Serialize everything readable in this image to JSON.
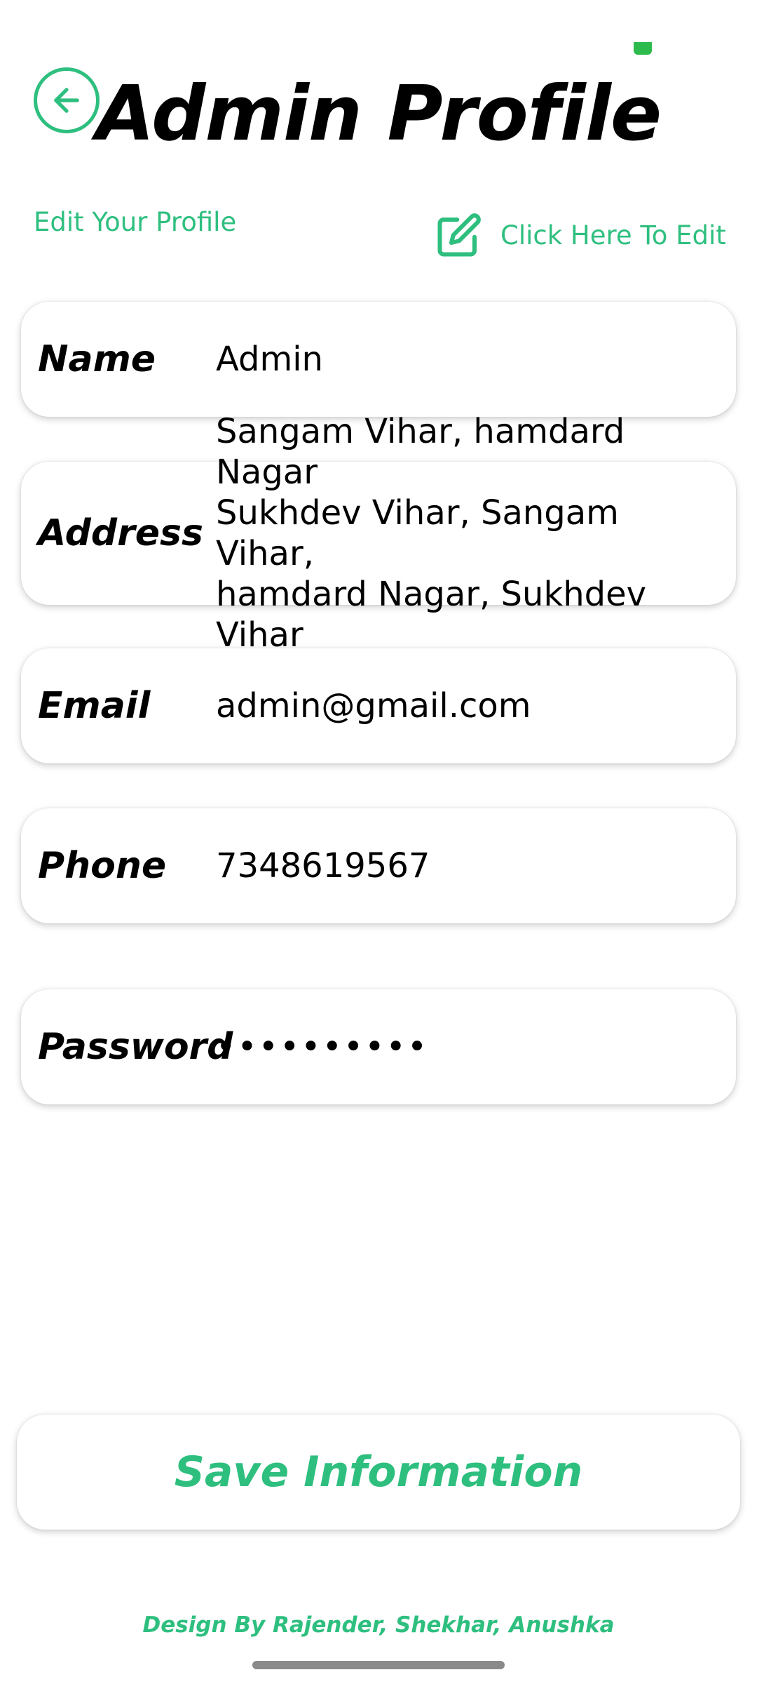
{
  "header": {
    "title": "Admin Profile",
    "back_icon": "arrow-left-circle-icon"
  },
  "subheader": {
    "subtitle": "Edit Your Profile",
    "edit_label": "Click Here To Edit",
    "edit_icon": "edit-square-pen-icon"
  },
  "fields": [
    {
      "label": "Name",
      "value": "Admin"
    },
    {
      "label": "Address",
      "value": "Sangam Vihar, hamdard Nagar\nSukhdev Vihar, Sangam Vihar,\nhamdard Nagar, Sukhdev Vihar"
    },
    {
      "label": "Email",
      "value": "admin@gmail.com"
    },
    {
      "label": "Phone",
      "value": "7348619567"
    },
    {
      "label": "Password",
      "value": "••••••••••"
    }
  ],
  "actions": {
    "save_label": "Save Information"
  },
  "footer": {
    "credit": "Design By Rajender, Shekhar, Anushka"
  },
  "colors": {
    "accent": "#2ebf7f",
    "text": "#000000",
    "background": "#ffffff",
    "status_dot": "#2dbb4d"
  }
}
